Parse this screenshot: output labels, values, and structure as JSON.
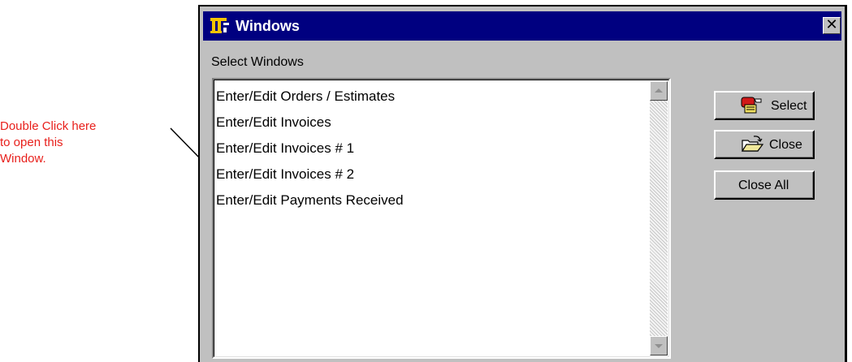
{
  "annotation": {
    "lines": [
      "Double Click here",
      "to open this",
      "Window."
    ]
  },
  "dialog": {
    "title": "Windows",
    "icon": "app-logo-icon",
    "close_glyph": "✕"
  },
  "group_label": "Select Windows",
  "list_items": [
    "Enter/Edit Orders / Estimates",
    "Enter/Edit Invoices",
    "Enter/Edit Invoices # 1",
    "Enter/Edit Invoices # 2",
    "Enter/Edit Payments Received"
  ],
  "buttons": {
    "select": {
      "label": "Select",
      "icon": "hand-pointing-icon"
    },
    "close": {
      "label": "Close",
      "icon": "folder-open-icon"
    },
    "close_all": {
      "label": "Close All"
    }
  },
  "colors": {
    "title_bar": "#000080",
    "annotation_text": "#e8201c",
    "window_face": "#c0c0c0"
  }
}
